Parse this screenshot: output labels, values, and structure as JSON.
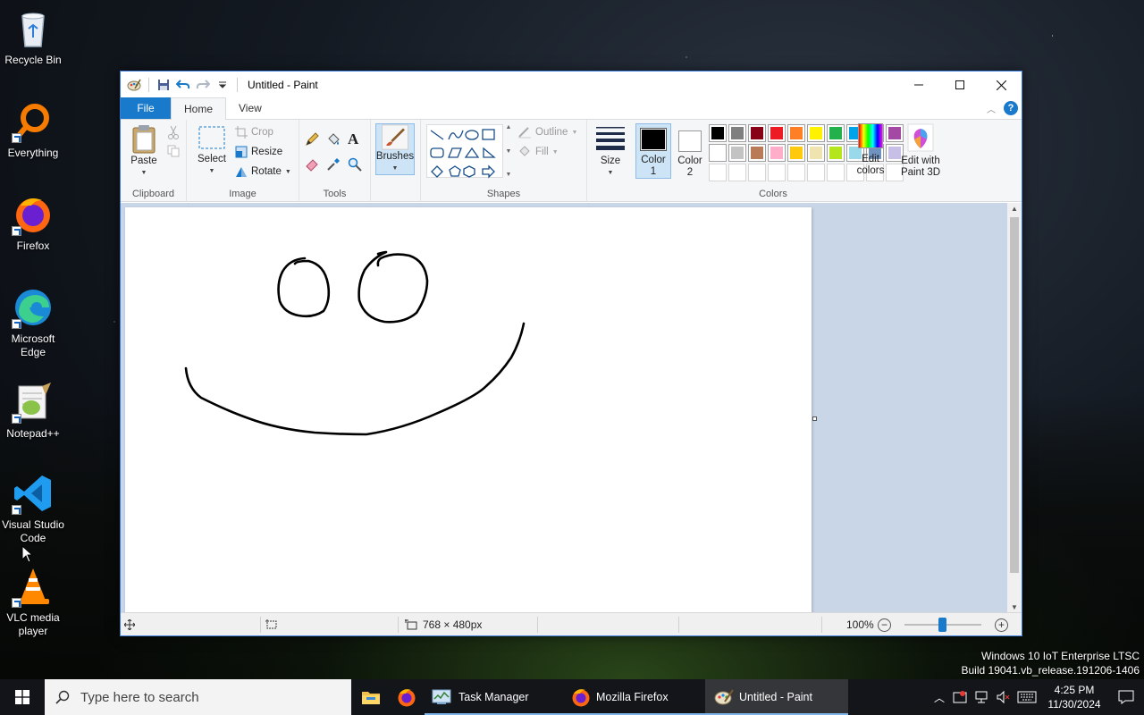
{
  "desktop": {
    "icons": [
      {
        "label": "Recycle Bin"
      },
      {
        "label": "Everything"
      },
      {
        "label": "Firefox"
      },
      {
        "label": "Microsoft Edge"
      },
      {
        "label": "Notepad++"
      },
      {
        "label": "Visual Studio Code"
      },
      {
        "label": "VLC media player"
      }
    ],
    "watermark_line1": "Windows 10 IoT Enterprise LTSC",
    "watermark_line2": "Build 19041.vb_release.191206-1406"
  },
  "paint": {
    "title": "Untitled - Paint",
    "tabs": {
      "file": "File",
      "home": "Home",
      "view": "View"
    },
    "help": "?",
    "clipboard": {
      "paste": "Paste",
      "group": "Clipboard"
    },
    "image": {
      "select": "Select",
      "crop": "Crop",
      "resize": "Resize",
      "rotate": "Rotate",
      "group": "Image"
    },
    "tools": {
      "group": "Tools",
      "text_glyph": "A"
    },
    "brushes": {
      "label": "Brushes"
    },
    "shapes": {
      "outline": "Outline",
      "fill": "Fill",
      "group": "Shapes"
    },
    "size": {
      "label": "Size"
    },
    "color1": {
      "label": "Color",
      "num": "1",
      "value": "#000000"
    },
    "color2": {
      "label": "Color",
      "num": "2",
      "value": "#ffffff"
    },
    "colors": {
      "group": "Colors",
      "edit_line1": "Edit",
      "edit_line2": "colors",
      "row1": [
        "#000000",
        "#7f7f7f",
        "#880015",
        "#ed1c24",
        "#ff7f27",
        "#fff200",
        "#22b14c",
        "#00a2e8",
        "#3f48cc",
        "#a349a4"
      ],
      "row2": [
        "#ffffff",
        "#c3c3c3",
        "#b97a57",
        "#ffaec9",
        "#ffc90e",
        "#efe4b0",
        "#b5e61d",
        "#99d9ea",
        "#7092be",
        "#c8bfe7"
      ]
    },
    "paint3d": {
      "line1": "Edit with",
      "line2": "Paint 3D"
    },
    "status": {
      "dimensions": "768 × 480px",
      "zoom": "100%",
      "zoom_level_percent": 100
    }
  },
  "taskbar": {
    "search_placeholder": "Type here to search",
    "apps": [
      {
        "label": "Task Manager"
      },
      {
        "label": "Mozilla Firefox"
      },
      {
        "label": "Untitled - Paint"
      }
    ],
    "time": "4:25 PM",
    "date": "11/30/2024"
  }
}
